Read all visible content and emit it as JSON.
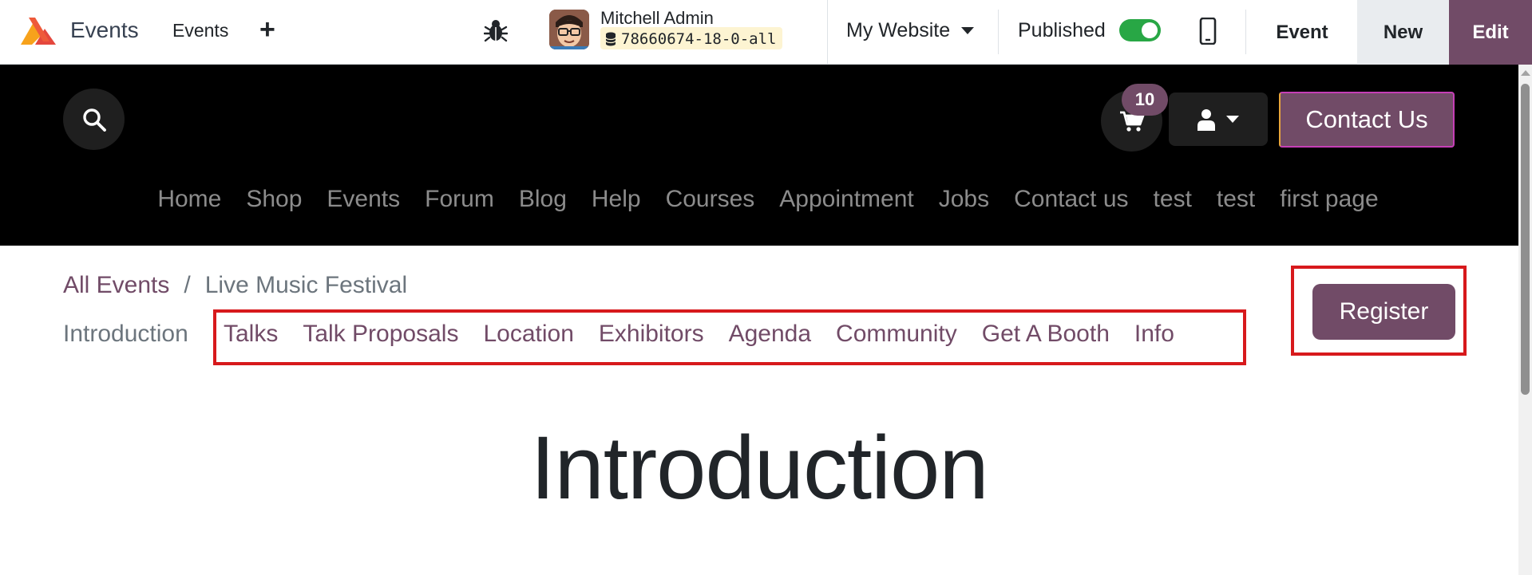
{
  "topbar": {
    "app_name": "Events",
    "menu_events": "Events",
    "new_icon": "plus-icon",
    "debug_icon": "bug-icon",
    "user_name": "Mitchell Admin",
    "database": "78660674-18-0-all",
    "website_selector": "My Website",
    "published_label": "Published",
    "published": true,
    "mobile_icon": "mobile-icon",
    "event_button": "Event",
    "new_button": "New",
    "edit_button": "Edit"
  },
  "header": {
    "search_icon": "search-icon",
    "cart_icon": "cart-icon",
    "cart_count": "10",
    "user_icon": "user-icon",
    "contact_button": "Contact Us",
    "nav": [
      "Home",
      "Shop",
      "Events",
      "Forum",
      "Blog",
      "Help",
      "Courses",
      "Appointment",
      "Jobs",
      "Contact us",
      "test",
      "test",
      "first page"
    ]
  },
  "event": {
    "breadcrumb_root": "All Events",
    "breadcrumb_sep": "/",
    "breadcrumb_current": "Live Music Festival",
    "tab_introduction": "Introduction",
    "tabs": [
      "Talks",
      "Talk Proposals",
      "Location",
      "Exhibitors",
      "Agenda",
      "Community",
      "Get A Booth",
      "Info"
    ],
    "register_button": "Register",
    "heading": "Introduction"
  },
  "colors": {
    "brand": "#714b67",
    "highlight": "#d7191c",
    "toggle_on": "#28a745"
  }
}
